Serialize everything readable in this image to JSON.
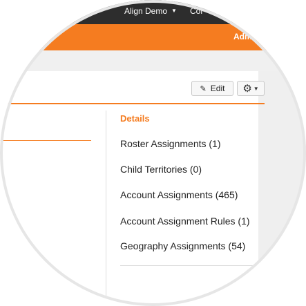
{
  "topbar": {
    "items": [
      {
        "label": "Align Demo",
        "has_caret": true
      },
      {
        "label": "Cor"
      }
    ]
  },
  "orange_bar": {
    "link": "Adm"
  },
  "toolbar": {
    "edit_label": "Edit",
    "edit_icon": "pencil-icon",
    "settings_icon": "gear-icon"
  },
  "nav": {
    "items": [
      {
        "label": "Details",
        "active": true
      },
      {
        "label": "Roster Assignments (1)"
      },
      {
        "label": "Child Territories (0)"
      },
      {
        "label": "Account Assignments (465)"
      },
      {
        "label": "Account Assignment Rules (1)"
      },
      {
        "label": "Geography Assignments (54)"
      }
    ]
  },
  "colors": {
    "accent": "#f57c20",
    "topbar": "#2d2d2d",
    "background": "#ffffff"
  }
}
